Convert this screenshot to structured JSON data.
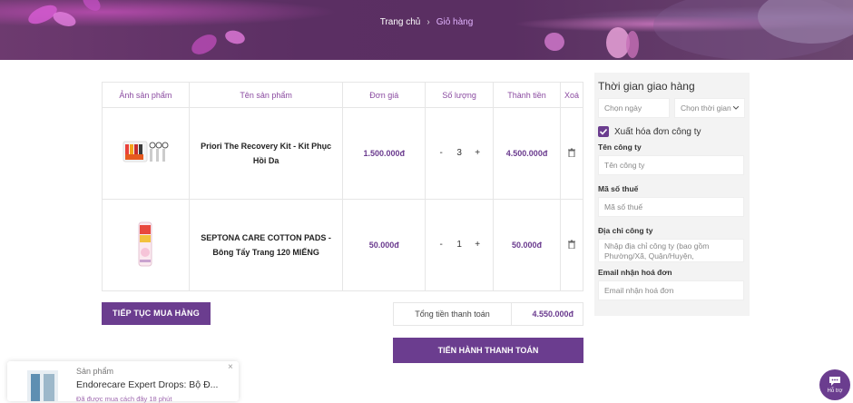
{
  "breadcrumb": {
    "home": "Trang chủ",
    "separator": "›",
    "current": "Giỏ hàng"
  },
  "cart": {
    "headers": [
      "Ảnh sản phẩm",
      "Tên sản phẩm",
      "Đơn giá",
      "Số lượng",
      "Thành tiền",
      "Xoá"
    ],
    "items": [
      {
        "name": "Priori The Recovery Kit - Kit Phục Hồi Da",
        "price": "1.500.000đ",
        "qty": "3",
        "subtotal": "4.500.000đ"
      },
      {
        "name": "SEPTONA CARE COTTON PADS - Bông Tẩy Trang 120 MIẾNG",
        "price": "50.000đ",
        "qty": "1",
        "subtotal": "50.000đ"
      }
    ],
    "qty_minus": "-",
    "qty_plus": "+",
    "continue_label": "TIẾP TỤC MUA HÀNG",
    "total_label": "Tổng tiền thanh toán",
    "total_value": "4.550.000đ",
    "checkout_label": "TIẾN HÀNH THANH TOÁN"
  },
  "delivery": {
    "title": "Thời gian giao hàng",
    "date_placeholder": "Chọn ngày",
    "time_placeholder": "Chọn thời gian",
    "invoice_label": "Xuất hóa đơn công ty",
    "invoice_checked": true,
    "company_label": "Tên công ty",
    "company_placeholder": "Tên công ty",
    "tax_label": "Mã số thuế",
    "tax_placeholder": "Mã số thuế",
    "address_label": "Địa chỉ công ty",
    "address_placeholder": "Nhập địa chỉ công ty (bao gồm Phường/Xã, Quận/Huyện,",
    "email_label": "Email nhận hoá đơn",
    "email_placeholder": "Email nhận hoá đơn"
  },
  "popup": {
    "kicker": "Sản phẩm",
    "product": "Endorecare Expert Drops: Bộ Đ...",
    "subtext": "Đã được mua cách đây 18 phút",
    "close": "×"
  },
  "support": {
    "label": "Hỗ trợ"
  },
  "colors": {
    "accent": "#6b3d8f",
    "price": "#6a3a8e",
    "header_text": "#8a4aa0"
  }
}
